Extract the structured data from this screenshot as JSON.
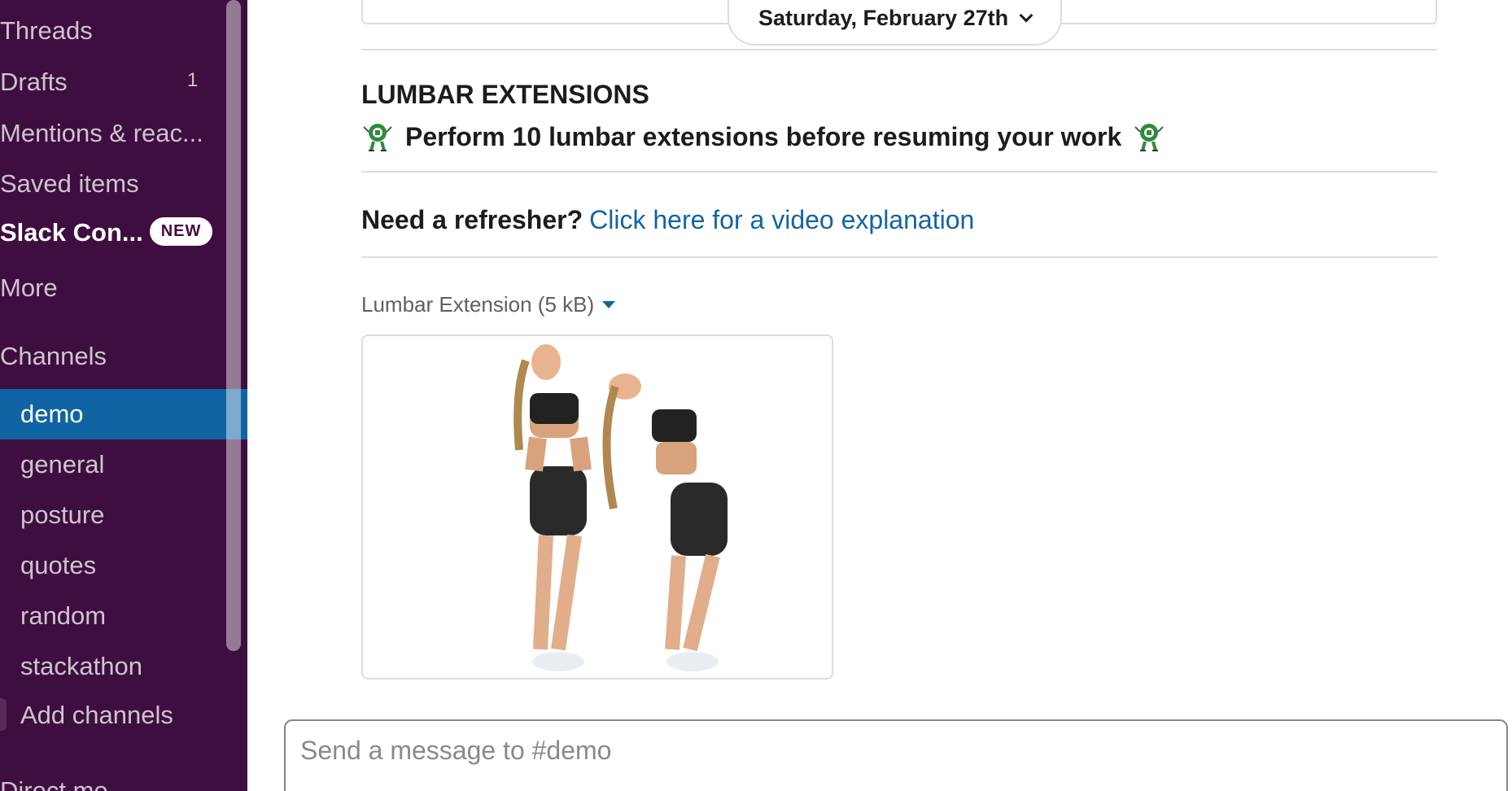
{
  "sidebar": {
    "nav": {
      "threads": "Threads",
      "drafts": "Drafts",
      "drafts_count": "1",
      "mentions": "Mentions & reac...",
      "saved": "Saved items",
      "slack_connect": "Slack Con...",
      "slack_connect_badge": "NEW",
      "more": "More"
    },
    "channels_header": "Channels",
    "channels": [
      "demo",
      "general",
      "posture",
      "quotes",
      "random",
      "stackathon"
    ],
    "active_channel": "demo",
    "add_channels": "Add channels",
    "direct_messages_header": "Direct me..."
  },
  "main": {
    "date_divider": "Saturday, February 27th",
    "message": {
      "heading": "LUMBAR EXTENSIONS",
      "instruction": "Perform 10 lumbar extensions before resuming your work",
      "refresher_label": "Need a refresher?",
      "refresher_link": "Click here for a video explanation",
      "file_name": "Lumbar Extension (5 kB)"
    },
    "composer_placeholder": "Send a message to #demo"
  },
  "colors": {
    "sidebar_bg": "#3f0e40",
    "active_channel_bg": "#1164a3",
    "link": "#1264a3"
  }
}
